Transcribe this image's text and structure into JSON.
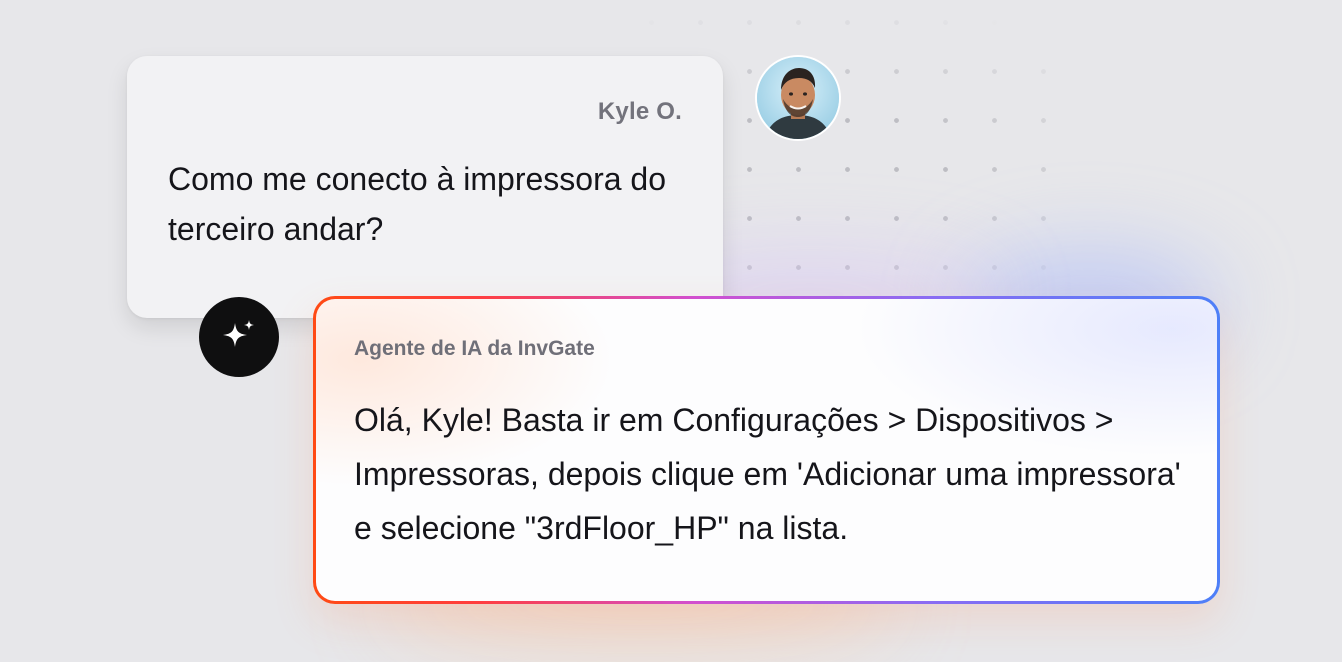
{
  "conversation": {
    "user": {
      "name": "Kyle O.",
      "message": "Como me conecto à impressora do terceiro andar?"
    },
    "agent": {
      "name": "Agente de IA da InvGate",
      "message": "Olá, Kyle! Basta ir em Configurações > Dispositivos > Impressoras, depois clique em 'Adicionar uma impressora' e selecione \"3rdFloor_HP\" na lista."
    }
  },
  "icons": {
    "agent_badge": "sparkle-icon",
    "user_avatar": "user-avatar-photo"
  },
  "colors": {
    "background": "#e7e7ea",
    "user_bubble": "#f2f2f4",
    "agent_badge": "#0f0f10",
    "border_gradient_start": "#ff4a14",
    "border_gradient_mid": "#d24fcf",
    "border_gradient_end": "#4d7ff8"
  }
}
